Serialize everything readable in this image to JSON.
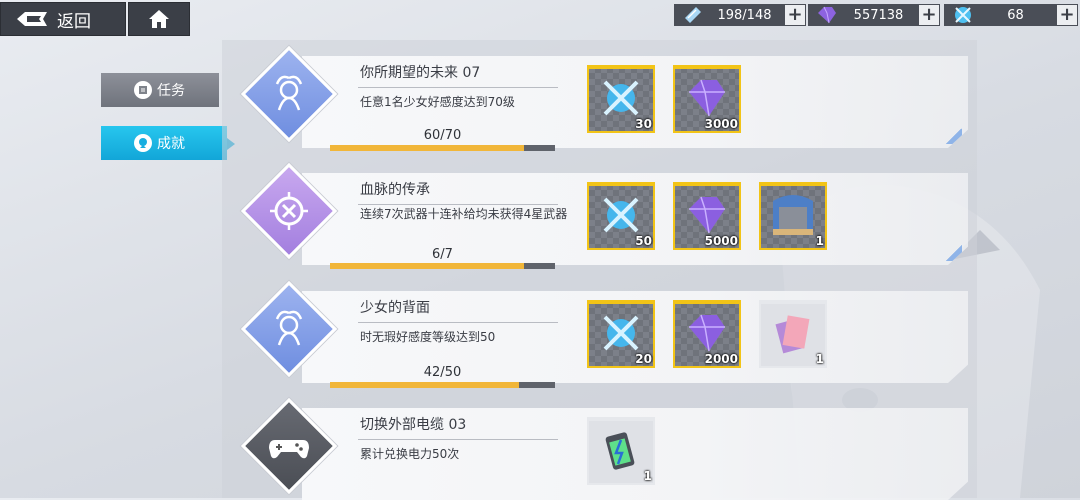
{
  "topbar": {
    "back_label": "返回",
    "resources": [
      {
        "icon": "ticket-icon",
        "value": "198/148"
      },
      {
        "icon": "crystal-icon",
        "value": "557138"
      },
      {
        "icon": "energy-orb-icon",
        "value": "68"
      }
    ]
  },
  "sidebar": {
    "tabs": [
      {
        "label": "任务",
        "active": false
      },
      {
        "label": "成就",
        "active": true
      }
    ]
  },
  "achievements": [
    {
      "icon": "character-emblem-icon",
      "title": "你所期望的未来 07",
      "description": "任意1名少女好感度达到70级",
      "progress": "60/70",
      "progress_fraction": 0.86,
      "rewards": [
        {
          "icon": "blue-orb-icon",
          "qty": "30"
        },
        {
          "icon": "purple-crystal-icon",
          "qty": "3000"
        }
      ]
    },
    {
      "icon": "weapon-emblem-icon",
      "title": "血脉的传承",
      "description": "连续7次武器十连补给均未获得4星武器",
      "progress": "6/7",
      "progress_fraction": 0.86,
      "rewards": [
        {
          "icon": "blue-orb-icon",
          "qty": "50"
        },
        {
          "icon": "purple-crystal-icon",
          "qty": "5000"
        },
        {
          "icon": "frame-decoration-icon",
          "qty": "1"
        }
      ]
    },
    {
      "icon": "character-emblem-icon",
      "title": "少女的背面",
      "description": "时无瑕好感度等级达到50",
      "progress": "42/50",
      "progress_fraction": 0.84,
      "rewards": [
        {
          "icon": "blue-orb-icon",
          "qty": "20"
        },
        {
          "icon": "purple-crystal-icon",
          "qty": "2000"
        },
        {
          "icon": "card-icon",
          "qty": "1"
        }
      ]
    },
    {
      "icon": "gamepad-icon",
      "title": "切换外部电缆 03",
      "description": "累计兑换电力50次",
      "rewards": [
        {
          "icon": "battery-icon",
          "qty": "1"
        }
      ]
    }
  ]
}
